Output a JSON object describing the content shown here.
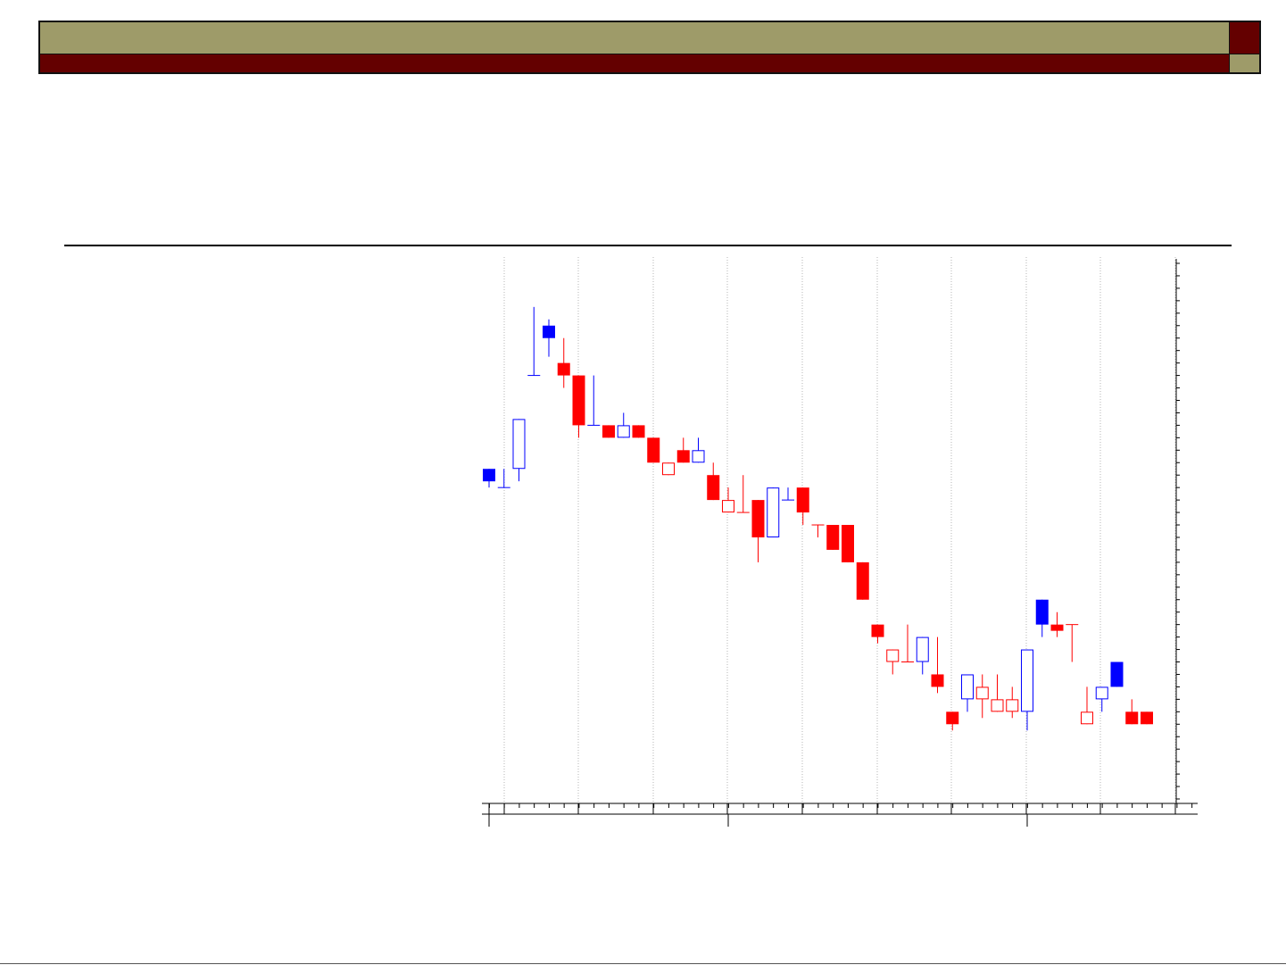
{
  "theme": {
    "olive": "#9e9b69",
    "maroon": "#640000",
    "rise_color": "#0000ff",
    "fall_color": "#ff0000"
  },
  "chart_data": {
    "type": "candlestick",
    "title": "",
    "xlabel": "",
    "ylabel": "",
    "grid": "vertical",
    "ylim": [
      0,
      43
    ],
    "axis_position": "right",
    "tick_labels": "none",
    "candles": [
      {
        "o": 26.5,
        "h": 26.5,
        "l": 25.0,
        "c": 25.5,
        "color": "blue",
        "filled": true
      },
      {
        "o": 25.0,
        "h": 26.5,
        "l": 25.0,
        "c": 25.0,
        "color": "blue",
        "filled": true
      },
      {
        "o": 26.5,
        "h": 30.5,
        "l": 25.5,
        "c": 30.5,
        "color": "blue",
        "filled": false
      },
      {
        "o": 34.0,
        "h": 39.5,
        "l": 34.0,
        "c": 34.0,
        "color": "blue",
        "filled": true
      },
      {
        "o": 37.0,
        "h": 38.5,
        "l": 35.5,
        "c": 38.0,
        "color": "blue",
        "filled": true
      },
      {
        "o": 35.0,
        "h": 37.0,
        "l": 33.0,
        "c": 34.0,
        "color": "red",
        "filled": true
      },
      {
        "o": 34.0,
        "h": 34.0,
        "l": 29.0,
        "c": 30.0,
        "color": "red",
        "filled": true
      },
      {
        "o": 30.0,
        "h": 34.0,
        "l": 30.0,
        "c": 30.0,
        "color": "blue",
        "filled": true
      },
      {
        "o": 30.0,
        "h": 30.0,
        "l": 29.0,
        "c": 29.0,
        "color": "red",
        "filled": true
      },
      {
        "o": 29.0,
        "h": 31.0,
        "l": 29.0,
        "c": 30.0,
        "color": "blue",
        "filled": false
      },
      {
        "o": 30.0,
        "h": 30.0,
        "l": 29.0,
        "c": 29.0,
        "color": "red",
        "filled": true
      },
      {
        "o": 29.0,
        "h": 29.0,
        "l": 27.0,
        "c": 27.0,
        "color": "red",
        "filled": true
      },
      {
        "o": 27.0,
        "h": 27.0,
        "l": 26.0,
        "c": 26.0,
        "color": "red",
        "filled": false
      },
      {
        "o": 28.0,
        "h": 29.0,
        "l": 27.0,
        "c": 27.0,
        "color": "red",
        "filled": true
      },
      {
        "o": 27.0,
        "h": 29.0,
        "l": 27.0,
        "c": 28.0,
        "color": "blue",
        "filled": false
      },
      {
        "o": 26.0,
        "h": 27.0,
        "l": 24.0,
        "c": 24.0,
        "color": "red",
        "filled": true
      },
      {
        "o": 24.0,
        "h": 25.0,
        "l": 23.0,
        "c": 23.0,
        "color": "red",
        "filled": false
      },
      {
        "o": 23.0,
        "h": 26.0,
        "l": 23.0,
        "c": 23.0,
        "color": "red",
        "filled": true
      },
      {
        "o": 24.0,
        "h": 24.0,
        "l": 19.0,
        "c": 21.0,
        "color": "red",
        "filled": true
      },
      {
        "o": 21.0,
        "h": 25.0,
        "l": 21.0,
        "c": 25.0,
        "color": "blue",
        "filled": false
      },
      {
        "o": 24.0,
        "h": 25.0,
        "l": 24.0,
        "c": 24.0,
        "color": "blue",
        "filled": true
      },
      {
        "o": 25.0,
        "h": 25.0,
        "l": 22.0,
        "c": 23.0,
        "color": "red",
        "filled": true
      },
      {
        "o": 22.0,
        "h": 22.0,
        "l": 21.0,
        "c": 22.0,
        "color": "red",
        "filled": true
      },
      {
        "o": 22.0,
        "h": 22.0,
        "l": 20.0,
        "c": 20.0,
        "color": "red",
        "filled": true
      },
      {
        "o": 22.0,
        "h": 22.0,
        "l": 19.0,
        "c": 19.0,
        "color": "red",
        "filled": true
      },
      {
        "o": 19.0,
        "h": 19.0,
        "l": 16.0,
        "c": 16.0,
        "color": "red",
        "filled": true
      },
      {
        "o": 14.0,
        "h": 14.0,
        "l": 12.5,
        "c": 13.0,
        "color": "red",
        "filled": true
      },
      {
        "o": 12.0,
        "h": 12.0,
        "l": 10.0,
        "c": 11.0,
        "color": "red",
        "filled": false
      },
      {
        "o": 11.0,
        "h": 14.0,
        "l": 11.0,
        "c": 11.0,
        "color": "red",
        "filled": true
      },
      {
        "o": 11.0,
        "h": 13.0,
        "l": 10.0,
        "c": 13.0,
        "color": "blue",
        "filled": false
      },
      {
        "o": 10.0,
        "h": 13.0,
        "l": 8.5,
        "c": 9.0,
        "color": "red",
        "filled": true
      },
      {
        "o": 7.0,
        "h": 7.0,
        "l": 5.5,
        "c": 6.0,
        "color": "red",
        "filled": true
      },
      {
        "o": 8.0,
        "h": 10.0,
        "l": 7.0,
        "c": 10.0,
        "color": "blue",
        "filled": false
      },
      {
        "o": 9.0,
        "h": 10.0,
        "l": 6.5,
        "c": 8.0,
        "color": "red",
        "filled": false
      },
      {
        "o": 8.0,
        "h": 10.0,
        "l": 7.0,
        "c": 7.0,
        "color": "red",
        "filled": false
      },
      {
        "o": 8.0,
        "h": 9.0,
        "l": 6.5,
        "c": 7.0,
        "color": "red",
        "filled": false
      },
      {
        "o": 7.0,
        "h": 12.0,
        "l": 5.5,
        "c": 12.0,
        "color": "blue",
        "filled": false
      },
      {
        "o": 14.0,
        "h": 16.0,
        "l": 13.0,
        "c": 16.0,
        "color": "blue",
        "filled": true
      },
      {
        "o": 14.0,
        "h": 15.0,
        "l": 13.0,
        "c": 13.5,
        "color": "red",
        "filled": true
      },
      {
        "o": 14.0,
        "h": 14.0,
        "l": 11.0,
        "c": 14.0,
        "color": "red",
        "filled": true
      },
      {
        "o": 7.0,
        "h": 9.0,
        "l": 6.0,
        "c": 6.0,
        "color": "red",
        "filled": false
      },
      {
        "o": 8.0,
        "h": 9.0,
        "l": 7.0,
        "c": 9.0,
        "color": "blue",
        "filled": false
      },
      {
        "o": 9.0,
        "h": 11.0,
        "l": 9.0,
        "c": 11.0,
        "color": "blue",
        "filled": true
      },
      {
        "o": 7.0,
        "h": 8.0,
        "l": 6.0,
        "c": 6.0,
        "color": "red",
        "filled": true
      },
      {
        "o": 7.0,
        "h": 7.0,
        "l": 6.0,
        "c": 6.0,
        "color": "red",
        "filled": true
      }
    ]
  }
}
